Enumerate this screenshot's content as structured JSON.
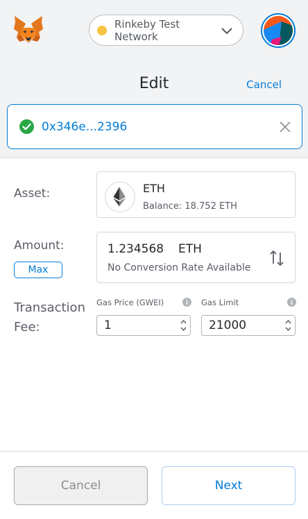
{
  "network": {
    "label": "Rinkeby Test Network",
    "dot_color": "#f6c343"
  },
  "header": {
    "title": "Edit",
    "cancel_label": "Cancel"
  },
  "recipient": {
    "address": "0x346e...2396",
    "status_icon": "check-circle-icon",
    "clear_icon": "close-icon"
  },
  "form": {
    "asset_label": "Asset:",
    "amount_label": "Amount:",
    "fee_label_line1": "Transaction",
    "fee_label_line2": "Fee:",
    "max_label": "Max"
  },
  "asset": {
    "symbol": "ETH",
    "balance": "Balance: 18.752 ETH",
    "icon": "ethereum-icon"
  },
  "amount": {
    "value": "1.234568",
    "unit": "ETH",
    "conversion": "No Conversion Rate Available",
    "swap_icon": "swap-arrows-icon"
  },
  "gas": {
    "price_label": "Gas Price (GWEI)",
    "price_value": "1",
    "limit_label": "Gas Limit",
    "limit_value": "21000"
  },
  "footer": {
    "cancel_label": "Cancel",
    "next_label": "Next"
  },
  "colors": {
    "accent": "#037dd6",
    "success": "#28a745",
    "header_bg": "#f2f3f4"
  }
}
